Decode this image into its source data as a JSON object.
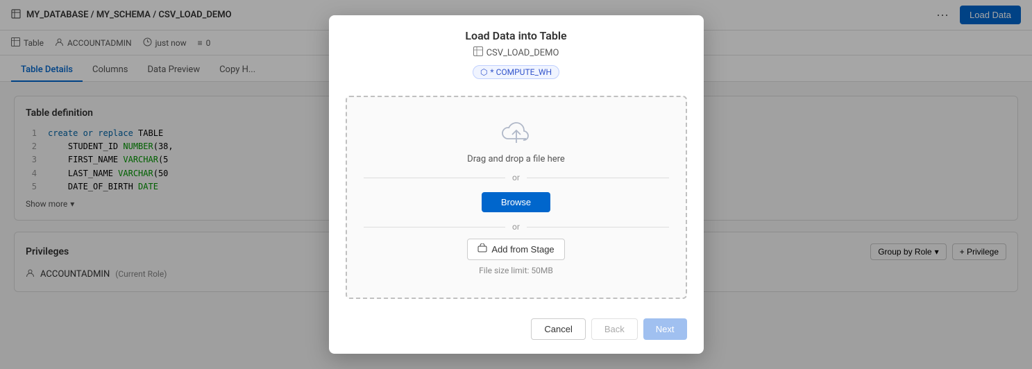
{
  "topbar": {
    "breadcrumb": "MY_DATABASE / MY_SCHEMA / CSV_LOAD_DEMO",
    "more_label": "···",
    "load_data_label": "Load Data"
  },
  "subtoolbar": {
    "type_label": "Table",
    "user_label": "ACCOUNTADMIN",
    "time_label": "just now",
    "count_label": "0"
  },
  "tabs": [
    {
      "label": "Table Details",
      "active": true
    },
    {
      "label": "Columns",
      "active": false
    },
    {
      "label": "Data Preview",
      "active": false
    },
    {
      "label": "Copy H...",
      "active": false
    }
  ],
  "table_definition": {
    "title": "Table definition",
    "lines": [
      {
        "num": "1",
        "code": "create or replace TABLE"
      },
      {
        "num": "2",
        "code": "    STUDENT_ID NUMBER(38,"
      },
      {
        "num": "3",
        "code": "    FIRST_NAME VARCHAR(5"
      },
      {
        "num": "4",
        "code": "    LAST_NAME VARCHAR(50"
      },
      {
        "num": "5",
        "code": "    DATE_OF_BIRTH DATE"
      }
    ],
    "show_more": "Show more"
  },
  "privileges": {
    "title": "Privileges",
    "group_by_label": "Group by Role",
    "add_privilege_label": "+ Privilege",
    "role_label": "ACCOUNTADMIN",
    "role_suffix": "(Current Role)"
  },
  "dialog": {
    "title": "Load Data into Table",
    "subtitle_table": "CSV_LOAD_DEMO",
    "badge_label": "* COMPUTE_WH",
    "drop_text": "Drag and drop a file here",
    "or_label": "or",
    "browse_label": "Browse",
    "add_stage_label": "Add from Stage",
    "file_size_limit": "File size limit: 50MB",
    "cancel_label": "Cancel",
    "back_label": "Back",
    "next_label": "Next",
    "cloud_icon": "☁"
  }
}
